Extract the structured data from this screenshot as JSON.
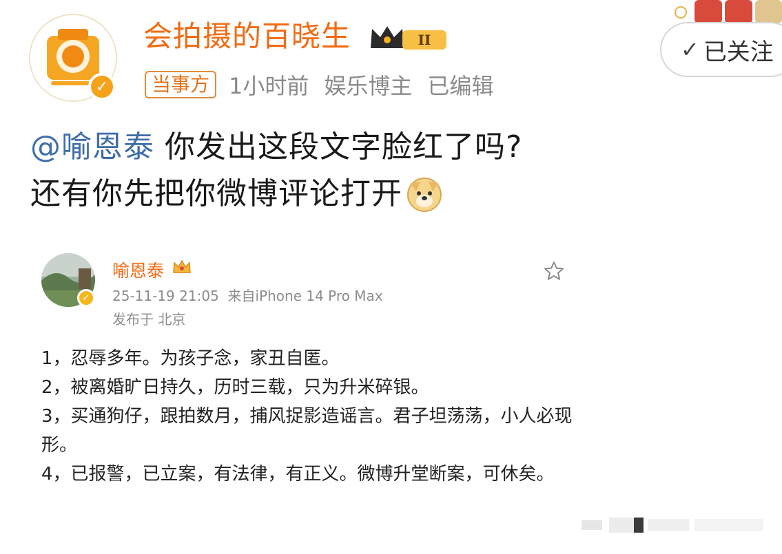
{
  "post": {
    "author": "会拍摄的百晓生",
    "vip_level": "II",
    "party_tag": "当事方",
    "time": "1小时前",
    "author_type": "娱乐博主",
    "edited": "已编辑",
    "follow_label": "已关注",
    "mention": "@喻恩泰",
    "text_line1": " 你发出这段文字脸红了吗?",
    "text_line2": "还有你先把你微博评论打开",
    "emoji": "doge-emoji"
  },
  "quoted": {
    "author": "喻恩泰",
    "datetime": "25-11-19 21:05",
    "source": "来自iPhone 14 Pro Max",
    "location": "发布于 北京",
    "lines": [
      "1，忍辱多年。为孩子念，家丑自匿。",
      "2，被离婚旷日持久，历时三载，只为升米碎银。",
      "3，买通狗仔，跟拍数月，捕风捉影造谣言。君子坦荡荡，小人必现形。",
      "4，已报警，已立案，有法律，有正义。微博升堂断案，可休矣。"
    ]
  },
  "colors": {
    "author_orange": "#f26a12",
    "mention_blue": "#3f6ea6",
    "meta_gray": "#8a8a8a",
    "verified_orange": "#f7a21b"
  }
}
